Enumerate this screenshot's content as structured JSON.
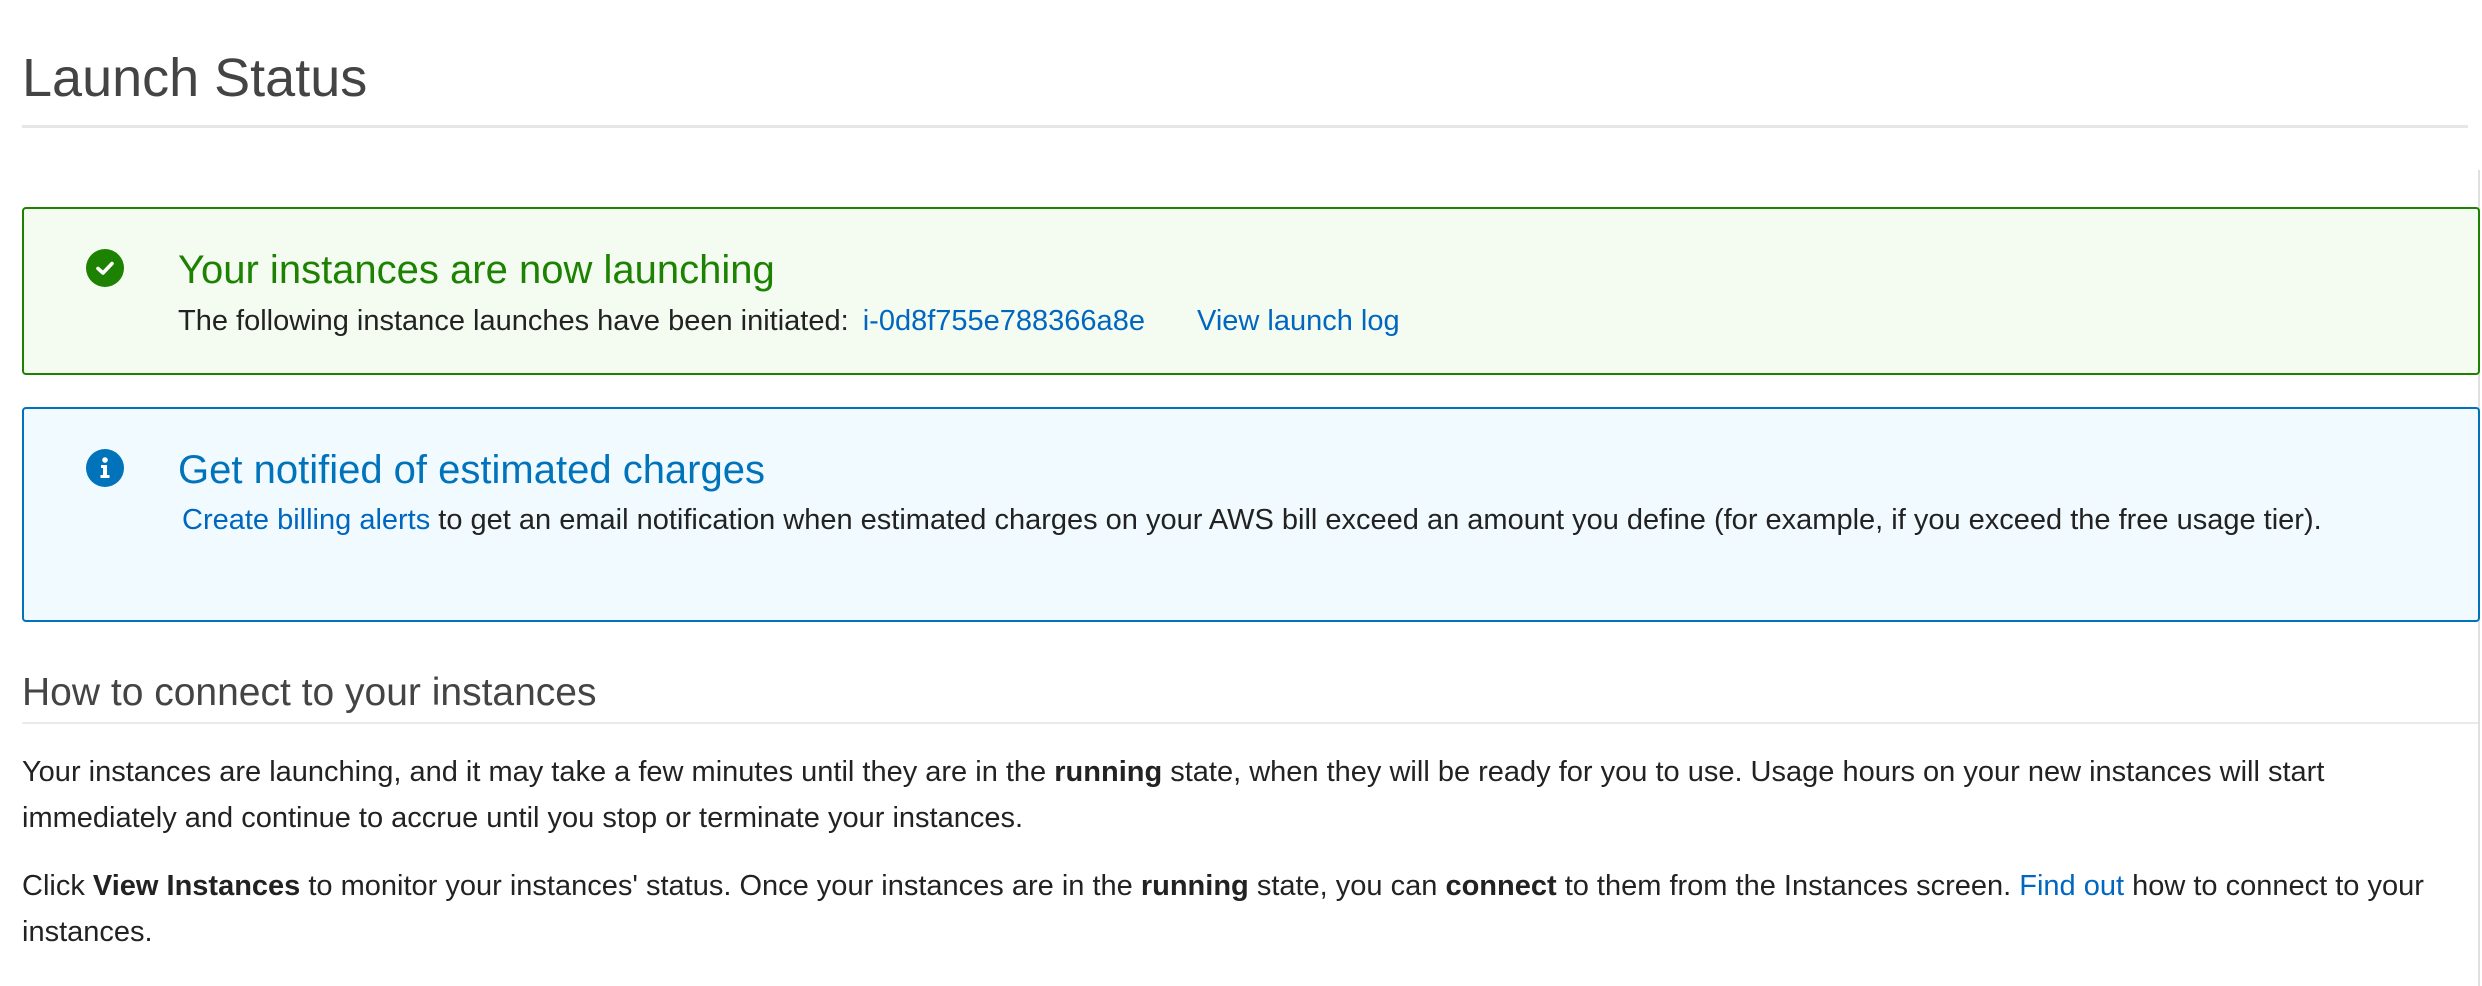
{
  "page": {
    "title": "Launch Status"
  },
  "success_alert": {
    "heading": "Your instances are now launching",
    "text": "The following instance launches have been initiated:",
    "instance_id": "i-0d8f755e788366a8e",
    "view_log_label": "View launch log",
    "color": "#1d8102"
  },
  "info_alert": {
    "heading": "Get notified of estimated charges",
    "link_label": "Create billing alerts",
    "text": "to get an email notification when estimated charges on your AWS bill exceed an amount you define (for example, if you exceed the free usage tier).",
    "color": "#0073bb"
  },
  "connect_section": {
    "heading": "How to connect to your instances",
    "para1": {
      "part1": "Your instances are launching, and it may take a few minutes until they are in the",
      "bold1": "running",
      "part2": "state, when they will be ready for you to use. Usage hours on your new instances will start immediately and continue to accrue until you stop or terminate your instances."
    },
    "para2": {
      "part1": "Click",
      "bold1": "View Instances",
      "part2": "to monitor your instances' status. Once your instances are in the",
      "bold2": "running",
      "part3": "state, you can",
      "bold3": "connect",
      "part4": "to them from the Instances screen.",
      "link": "Find out",
      "part5": "how to connect to your instances."
    }
  },
  "icons": {
    "success": "check-circle-icon",
    "info": "info-circle-icon"
  }
}
